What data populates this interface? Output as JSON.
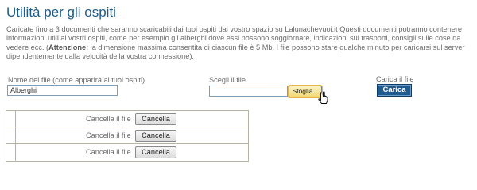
{
  "page": {
    "title": "Utilità per gli ospiti",
    "intro_text": "Caricate fino a 3 documenti che saranno scaricabili dai tuoi ospiti dal vostro spazio su Lalunachevuoi.it Questi documenti potranno contenere informazioni utili ai vostri ospiti, come per esempio gli alberghi dove essi possono soggiornare, indicazioni sui trasporti, consigli sulle cose da vedere ecc. (",
    "intro_bold": "Attenzione:",
    "intro_tail": " la dimensione massima consentita di ciascun file è 5 Mb. I file possono stare qualche minuto per caricarsi sul server dipendentemente dalla velocità della vostra connessione)."
  },
  "upload_form": {
    "file_name_label": "Nome del file (come apparirà ai tuoi ospiti)",
    "file_name_value": "Alberghi",
    "choose_file_label": "Scegli il file",
    "choose_file_value": "",
    "browse_label": "Sfoglia...",
    "upload_label": "Carica il file",
    "upload_button": "Carica"
  },
  "files_table": {
    "rows": [
      {
        "delete_label": "Cancella il file",
        "delete_button": "Cancella"
      },
      {
        "delete_label": "Cancella il file",
        "delete_button": "Cancella"
      },
      {
        "delete_label": "Cancella il file",
        "delete_button": "Cancella"
      }
    ]
  },
  "icons": {
    "cursor": "hand-pointer-icon"
  }
}
